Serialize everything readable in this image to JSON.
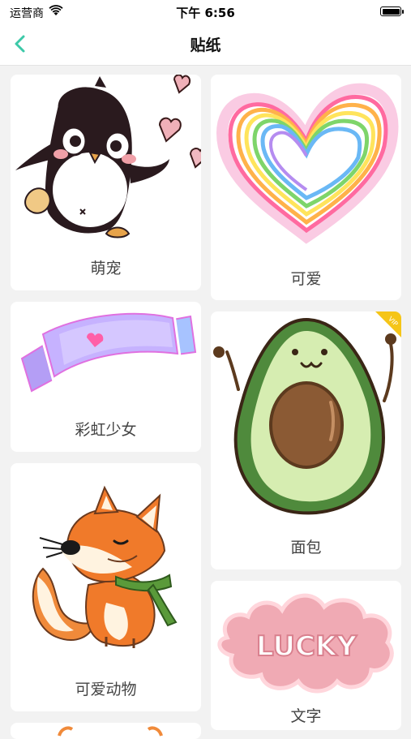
{
  "status_bar": {
    "carrier": "运营商",
    "time": "下午 6:56"
  },
  "nav": {
    "title": "贴纸",
    "back_icon": "chevron-left-icon",
    "accent": "#3cc9a8"
  },
  "categories": [
    {
      "label": "萌宠"
    },
    {
      "label": "可爱"
    },
    {
      "label": "彩虹少女"
    },
    {
      "label": "面包",
      "vip_badge": "VIP"
    },
    {
      "label": "可爱动物"
    },
    {
      "label": "文字",
      "sticker_text": "LUCKY"
    }
  ]
}
